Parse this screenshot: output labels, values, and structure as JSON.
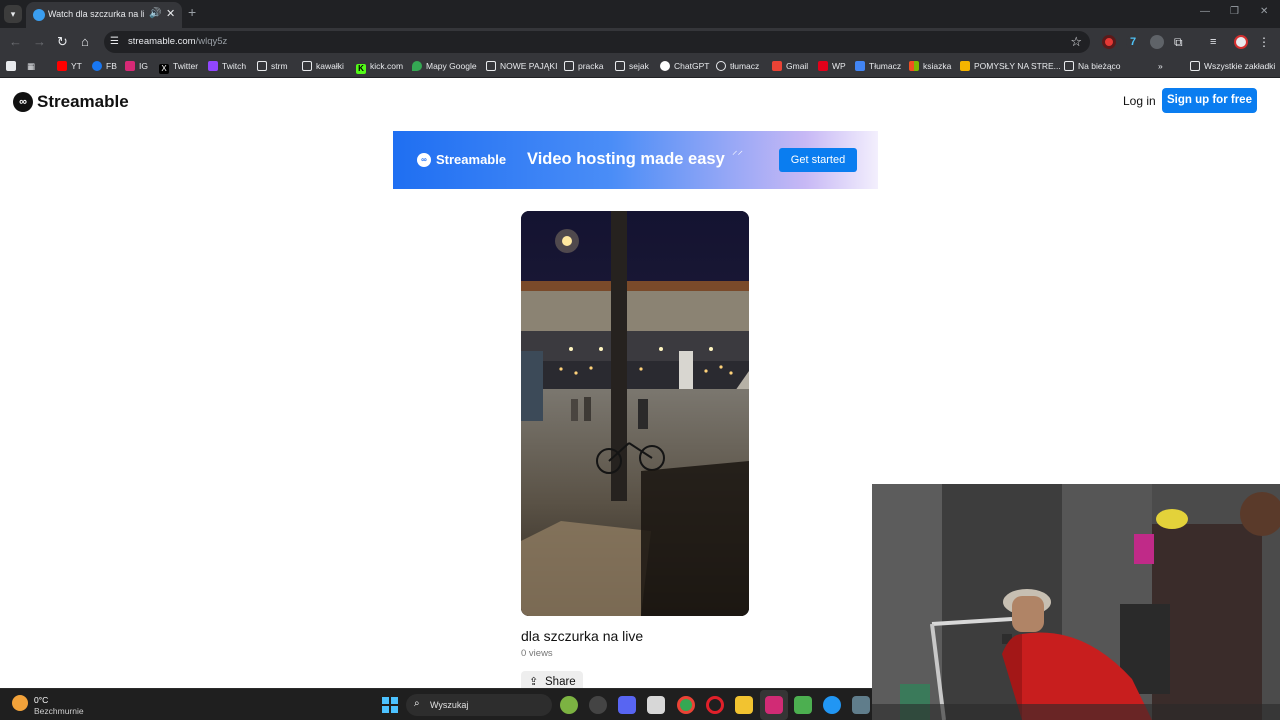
{
  "browser": {
    "tab_title": "Watch dla szczurka na live |",
    "url_host": "streamable.com",
    "url_path": "/wlqy5z"
  },
  "bookmarks": {
    "items": [
      {
        "label": "YT",
        "icon": "youtube-icon",
        "color": "#ff0000"
      },
      {
        "label": "FB",
        "icon": "facebook-icon",
        "color": "#1877f2"
      },
      {
        "label": "IG",
        "icon": "instagram-icon",
        "color": "#d62976"
      },
      {
        "label": "Twitter",
        "icon": "x-icon",
        "color": "#000000"
      },
      {
        "label": "Twitch",
        "icon": "twitch-icon",
        "color": "#9146ff"
      },
      {
        "label": "strm",
        "icon": "folder-icon",
        "color": "#35363a"
      },
      {
        "label": "kawałki",
        "icon": "folder-icon",
        "color": "#35363a"
      },
      {
        "label": "kick.com",
        "icon": "kick-icon",
        "color": "#53fc18"
      },
      {
        "label": "Mapy Google",
        "icon": "maps-icon",
        "color": "#34a853"
      },
      {
        "label": "NOWE PAJĄKI",
        "icon": "folder-icon",
        "color": "#35363a"
      },
      {
        "label": "pracka",
        "icon": "folder-icon",
        "color": "#35363a"
      },
      {
        "label": "sejak",
        "icon": "folder-icon",
        "color": "#35363a"
      },
      {
        "label": "ChatGPT",
        "icon": "chatgpt-icon",
        "color": "#ffffff"
      },
      {
        "label": "tłumacz",
        "icon": "globe-icon",
        "color": "#e8eaed"
      },
      {
        "label": "Gmail",
        "icon": "gmail-icon",
        "color": "#ea4335"
      },
      {
        "label": "WP",
        "icon": "wp-icon",
        "color": "#e2001a"
      },
      {
        "label": "Tłumacz",
        "icon": "translate-icon",
        "color": "#4285f4"
      },
      {
        "label": "ksiazka",
        "icon": "microsoft-icon",
        "color": "#f25022"
      },
      {
        "label": "POMYSŁY NA STRE...",
        "icon": "doc-icon",
        "color": "#f4b400"
      },
      {
        "label": "Na bieżąco",
        "icon": "folder-icon",
        "color": "#35363a"
      }
    ],
    "all_bookmarks": "Wszystkie zakładki"
  },
  "header": {
    "logo": "Streamable",
    "login": "Log in",
    "signup": "Sign up for free"
  },
  "banner": {
    "logo": "Streamable",
    "tagline": "Video hosting made easy",
    "cta": "Get started"
  },
  "video": {
    "title": "dla szczurka na live",
    "views": "0 views",
    "share": "Share"
  },
  "taskbar": {
    "temperature": "0°C",
    "condition": "Bezchmurnie",
    "search_placeholder": "Wyszukaj"
  }
}
